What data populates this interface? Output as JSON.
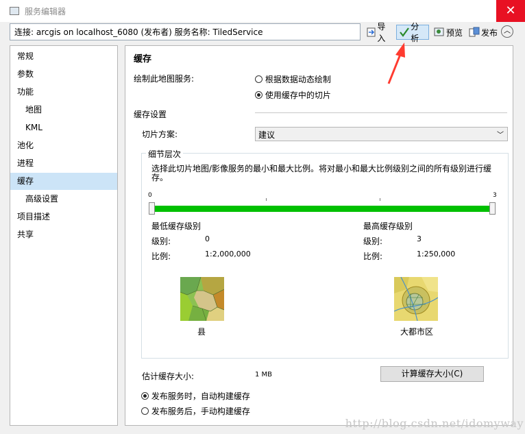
{
  "window": {
    "title": "服务编辑器"
  },
  "toolbar": {
    "connection_text": "连接: arcgis on localhost_6080 (发布者)    服务名称: TiledService",
    "import_label": "导入",
    "analyze_label": "分析",
    "preview_label": "预览",
    "publish_label": "发布"
  },
  "sidebar": {
    "items": [
      {
        "label": "常规"
      },
      {
        "label": "参数"
      },
      {
        "label": "功能"
      },
      {
        "label": "地图"
      },
      {
        "label": "KML"
      },
      {
        "label": "池化"
      },
      {
        "label": "进程"
      },
      {
        "label": "缓存"
      },
      {
        "label": "高级设置"
      },
      {
        "label": "项目描述"
      },
      {
        "label": "共享"
      }
    ]
  },
  "panel": {
    "title": "缓存",
    "draw_label": "绘制此地图服务:",
    "radio_dynamic": "根据数据动态绘制",
    "radio_cache": "使用缓存中的切片",
    "cache_settings": "缓存设置",
    "tiling_scheme_label": "切片方案:",
    "tiling_scheme_value": "建议",
    "lod_title": "细节层次",
    "lod_desc": "选择此切片地图/影像服务的最小和最大比例。将对最小和最大比例级别之间的所有级别进行缓存。",
    "slider_min_label": "0",
    "slider_max_label": "3",
    "slider_min_level": 0,
    "slider_max_level": 3,
    "min_title": "最低缓存级别",
    "max_title": "最高缓存级别",
    "level_label": "级别:",
    "scale_label": "比例:",
    "min_level_value": "0",
    "min_scale_value": "1:2,000,000",
    "max_level_value": "3",
    "max_scale_value": "1:250,000",
    "min_thumb_caption": "县",
    "max_thumb_caption": "大都市区",
    "est_size_label": "估计缓存大小:",
    "est_size_value": "1 MB",
    "calc_button": "计算缓存大小(C)",
    "radio_auto": "发布服务时，自动构建缓存",
    "radio_manual": "发布服务后，手动构建缓存"
  },
  "watermark": "http://blog.csdn.net/idomyway",
  "colors": {
    "slider_fill": "#00c000",
    "selection": "#cce4f7",
    "arrow": "#ff3b30"
  }
}
